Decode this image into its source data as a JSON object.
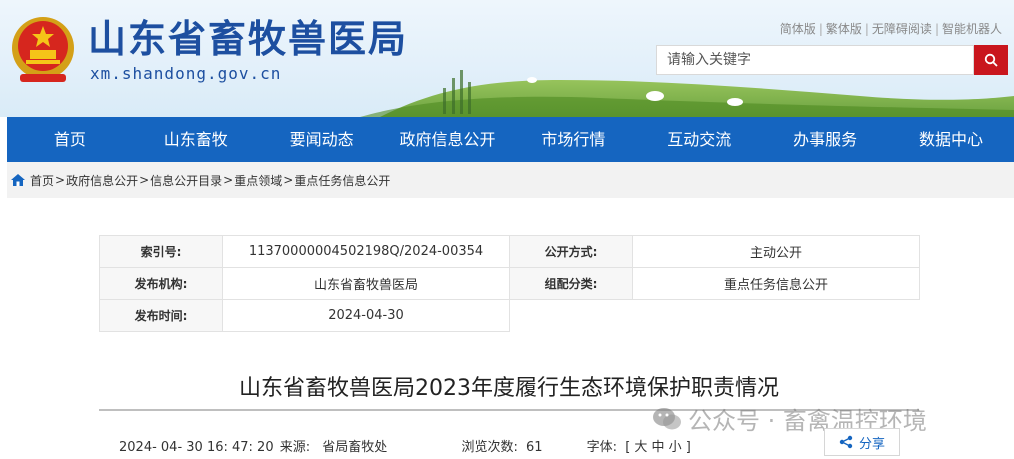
{
  "header": {
    "site_name": "山东省畜牧兽医局",
    "domain": "xm.shandong.gov.cn",
    "top_links": [
      "简体版",
      "繁体版",
      "无障碍阅读",
      "智能机器人"
    ],
    "search_placeholder": "请输入关键字"
  },
  "nav": {
    "items": [
      "首页",
      "山东畜牧",
      "要闻动态",
      "政府信息公开",
      "市场行情",
      "互动交流",
      "办事服务",
      "数据中心"
    ]
  },
  "breadcrumb": {
    "items": [
      "首页",
      "政府信息公开",
      "信息公开目录",
      "重点领域",
      "重点任务信息公开"
    ]
  },
  "info": {
    "index_label": "索引号:",
    "index_value": "11370000004502198Q/2024-00354",
    "open_mode_label": "公开方式:",
    "open_mode_value": "主动公开",
    "publisher_label": "发布机构:",
    "publisher_value": "山东省畜牧兽医局",
    "category_label": "组配分类:",
    "category_value": "重点任务信息公开",
    "date_label": "发布时间:",
    "date_value": "2024-04-30"
  },
  "article": {
    "title": "山东省畜牧兽医局2023年度履行生态环境保护职责情况",
    "datetime": "2024- 04- 30 16: 47: 20",
    "source_label": "来源:",
    "source_value": "省局畜牧处",
    "views_label": "浏览次数:",
    "views_value": "61",
    "font_label": "字体:",
    "font_sizes": "[ 大 中 小 ]",
    "share_label": "分享",
    "watermark": "公众号 · 畜禽温控环境"
  },
  "colors": {
    "nav_bg": "#1565c0",
    "search_button": "#c9161d",
    "title_blue": "#1d4fa0"
  }
}
